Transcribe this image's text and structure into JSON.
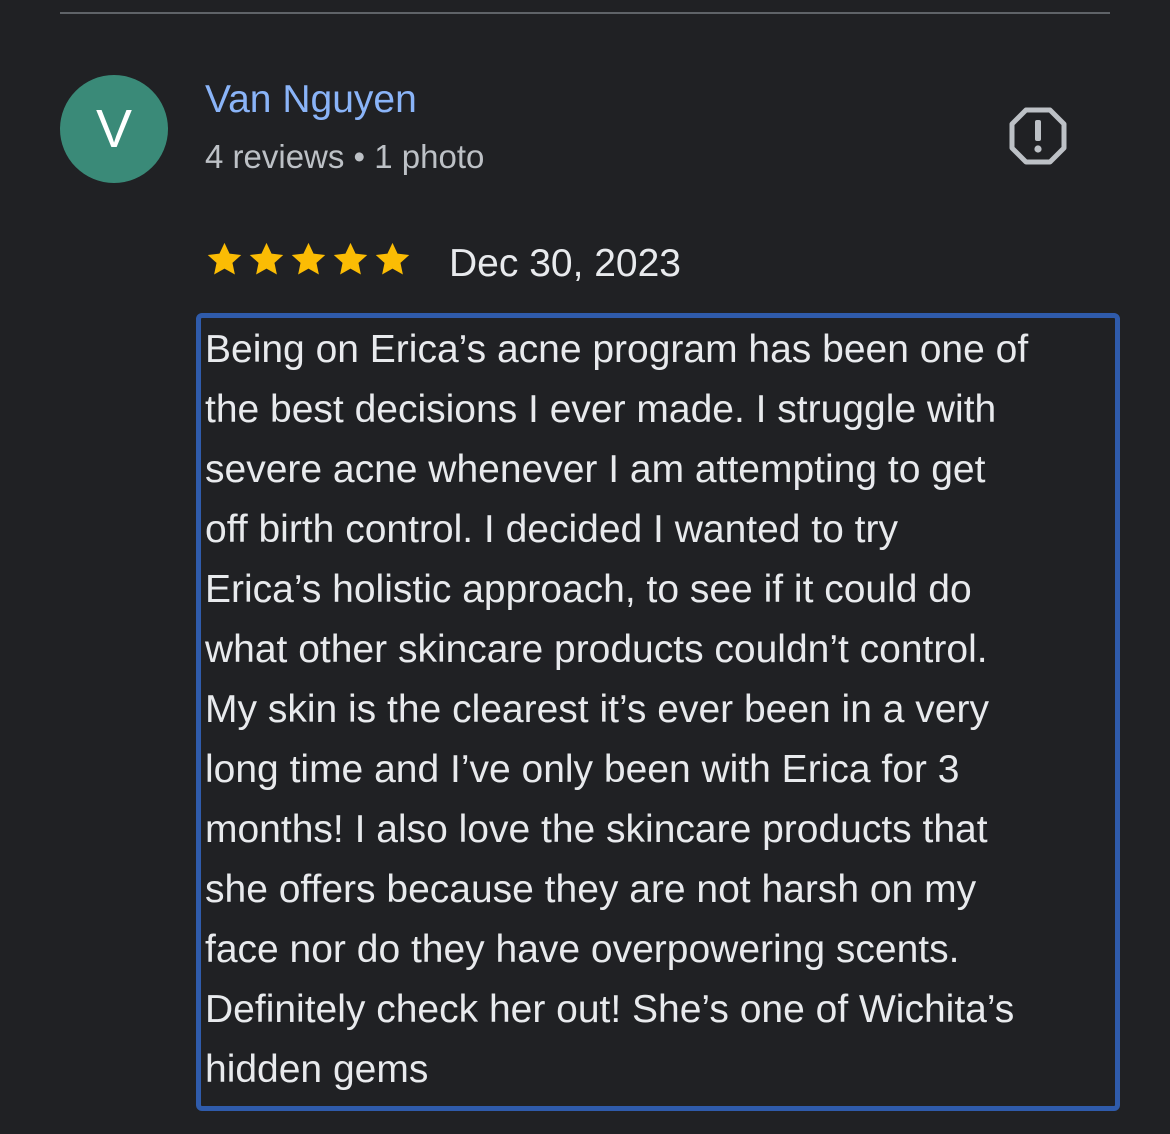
{
  "reviewer": {
    "initial": "V",
    "name": "Van Nguyen",
    "meta": "4 reviews • 1 photo",
    "avatar_color": "#3a8a78"
  },
  "actions": {
    "report_icon": "report-flag-icon"
  },
  "review": {
    "rating": 5,
    "max_rating": 5,
    "star_color": "#fbbc04",
    "date": "Dec 30, 2023",
    "lines": [
      "Being on Erica’s acne program has been one of",
      "the best decisions I ever made. I struggle with",
      "severe acne whenever I am attempting to get",
      "off birth control. I decided I wanted to try",
      "Erica’s holistic approach, to see if it could do",
      "what other skincare products couldn’t control.",
      "My skin is the clearest it’s ever been in a very",
      "long time and I’ve only been with Erica for 3",
      "months! I also love the skincare products that",
      "she offers because they are not harsh on my",
      "face nor do they have overpowering scents.",
      "Definitely check her out! She’s one of Wichita’s",
      "hidden gems"
    ]
  },
  "colors": {
    "background": "#202124",
    "name_link": "#8ab4f8",
    "highlight_border": "#2f5bab"
  }
}
